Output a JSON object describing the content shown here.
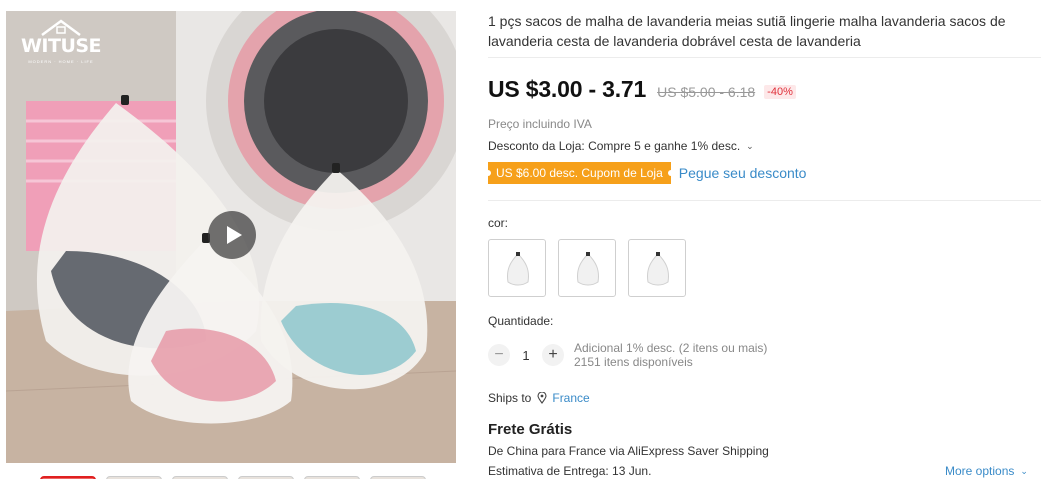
{
  "gallery": {
    "brand_name": "WITUSE",
    "brand_tagline": "MODERN · HOME · LIFE",
    "play_icon": "play-icon",
    "thumbnail_count": 6
  },
  "product": {
    "title": "1 pçs sacos de malha de lavanderia meias sutiã lingerie malha lavanderia sacos de lavanderia cesta de lavanderia dobrável cesta de lavanderia",
    "price": "US $3.00 - 3.71",
    "original_price": "US $5.00 - 6.18",
    "discount_badge": "-40%",
    "tax_note": "Preço incluindo IVA",
    "store_discount": "Desconto da Loja: Compre 5 e ganhe 1% desc.",
    "coupon_label": "US $6.00 desc. Cupom de Loja",
    "coupon_link": "Pegue seu desconto"
  },
  "variants": {
    "color_label": "cor:",
    "options": [
      "small-bag",
      "medium-bag",
      "large-bag"
    ]
  },
  "quantity": {
    "label": "Quantidade:",
    "minus": "−",
    "value": "1",
    "plus": "+",
    "bulk_note": "Adicional 1% desc. (2 itens ou mais)",
    "stock_note": "2151 itens disponíveis"
  },
  "shipping": {
    "ships_to_label": "Ships to",
    "destination": "France",
    "free_title": "Frete Grátis",
    "route_line": "De China para France via AliExpress Saver Shipping",
    "delivery_estimate": "Estimativa de Entrega: 13 Jun.",
    "more_options": "More options"
  },
  "colors": {
    "price_red": "#e0313b",
    "coupon_orange": "#f6a01a",
    "link_blue": "#3a8bc8"
  }
}
